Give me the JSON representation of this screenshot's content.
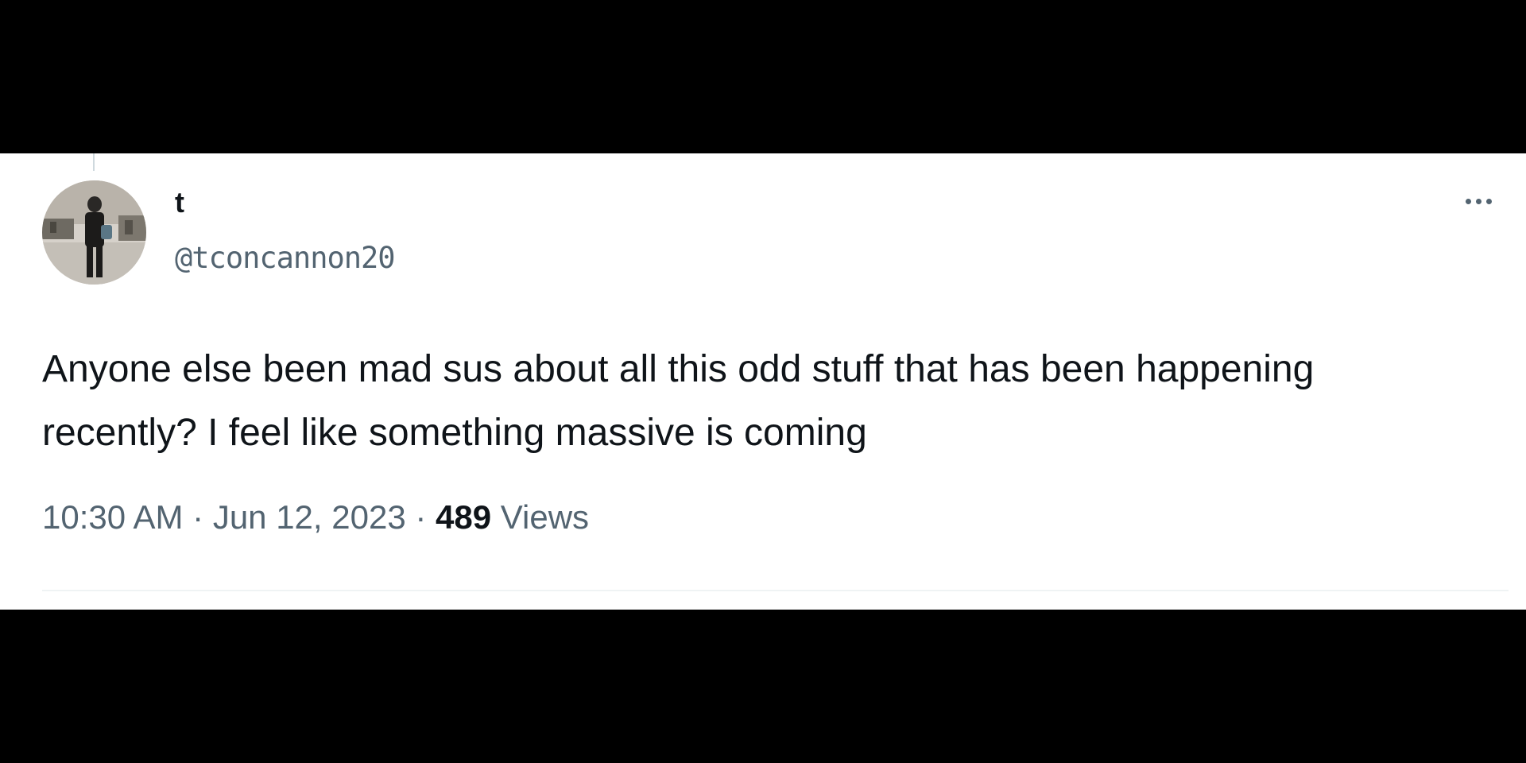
{
  "tweet": {
    "display_name": "t",
    "handle": "@tconcannon20",
    "text": "Anyone else been mad sus about all this odd stuff that has been happening recently? I feel like something massive is coming",
    "time": "10:30 AM",
    "separator": "·",
    "date": "Jun 12, 2023",
    "views_count": "489",
    "views_label": "Views",
    "more_icon": "more-horizontal-icon"
  },
  "colors": {
    "text_primary": "#0f1419",
    "text_secondary": "#536471",
    "divider": "#eff3f4",
    "letterbox": "#000000",
    "card_background": "#ffffff"
  }
}
